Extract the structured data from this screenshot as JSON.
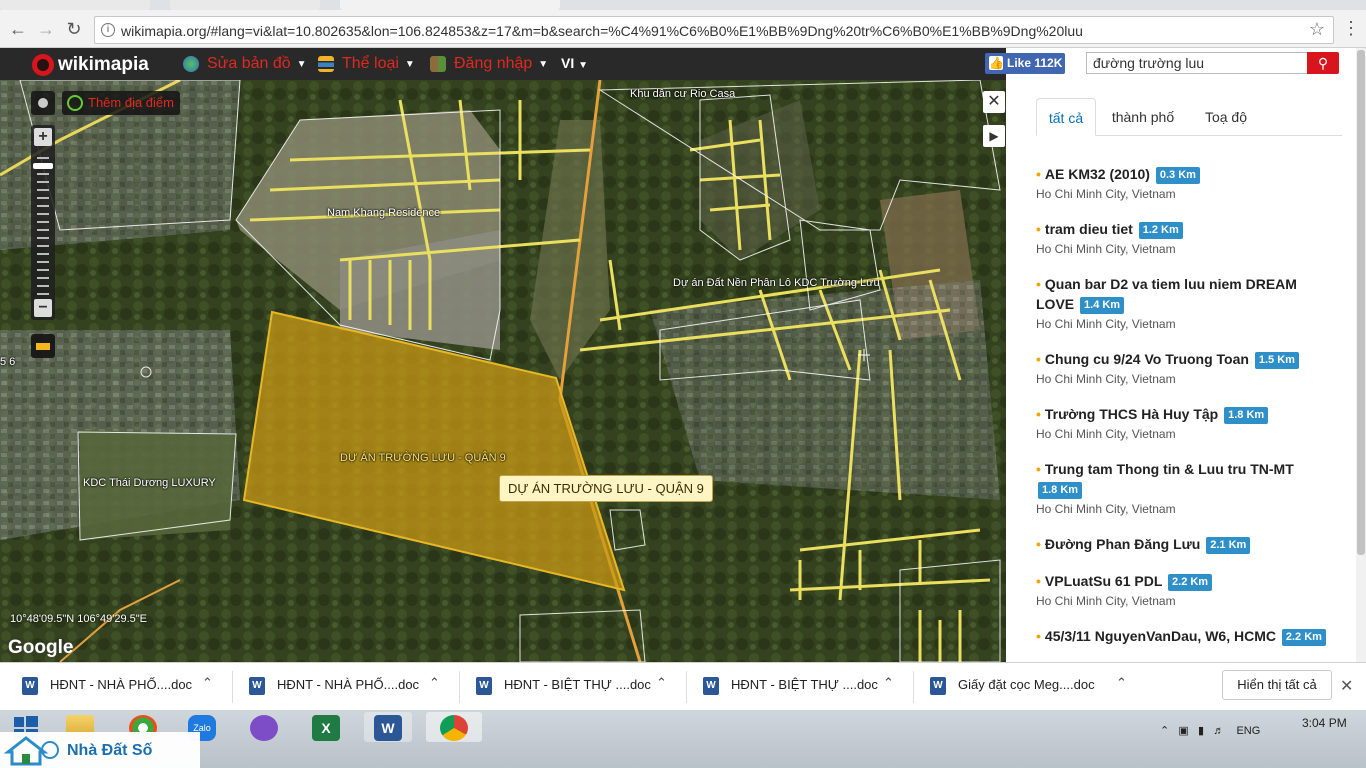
{
  "browser": {
    "url": "wikimapia.org/#lang=vi&lat=10.802635&lon=106.824853&z=17&m=b&search=%C4%91%C6%B0%E1%BB%9Dng%20tr%C6%B0%E1%BB%9Dng%20luu"
  },
  "header": {
    "logo": "wikimapia",
    "menu": [
      "Sửa bản đồ",
      "Thể loại",
      "Đăng nhập"
    ],
    "lang": "VI",
    "fb_like": "Like 112K",
    "search_value": "đường trường luu"
  },
  "map": {
    "add_place": "Thêm địa điểm",
    "labels": {
      "rio_casa": "Khu dân cư Rio Casa",
      "nam_khang": "Nam Khang Residence",
      "du_an_kdc": "Dự án Đất Nền Phân Lô KDC Trường Lưu",
      "du_an_center": "DỰ ÁN TRƯỜNG LƯU - QUẬN 9",
      "kdc_thai_duong": "KDC Thái Dương LUXURY",
      "left_edge": "5 6"
    },
    "tooltip": "DỰ ÁN TRƯỜNG LƯU - QUẬN 9",
    "coordinates": "10°48'09.5\"N 106°49'29.5\"E",
    "attribution": "Google"
  },
  "panel": {
    "tabs": [
      "tất cả",
      "thành phố",
      "Toạ độ"
    ],
    "results": [
      {
        "title": "AE KM32 (2010)",
        "dist": "0.3 Km",
        "sub": "Ho Chi Minh City, Vietnam"
      },
      {
        "title": "tram dieu tiet",
        "dist": "1.2 Km",
        "sub": "Ho Chi Minh City, Vietnam"
      },
      {
        "title": "Quan bar D2 va tiem luu niem DREAM LOVE",
        "dist": "1.4 Km",
        "sub": "Ho Chi Minh City, Vietnam"
      },
      {
        "title": "Chung cu 9/24 Vo Truong Toan",
        "dist": "1.5 Km",
        "sub": "Ho Chi Minh City, Vietnam"
      },
      {
        "title": "Trường THCS Hà Huy Tập",
        "dist": "1.8 Km",
        "sub": "Ho Chi Minh City, Vietnam"
      },
      {
        "title": "Trung tam Thong tin & Luu tru TN-MT",
        "dist": "1.8 Km",
        "sub": "Ho Chi Minh City, Vietnam"
      },
      {
        "title": "Đường Phan Đăng Lưu",
        "dist": "2.1 Km",
        "sub": ""
      },
      {
        "title": "VPLuatSu 61 PDL",
        "dist": "2.2 Km",
        "sub": "Ho Chi Minh City, Vietnam"
      },
      {
        "title": "45/3/11 NguyenVanDau, W6, HCMC",
        "dist": "2.2 Km",
        "sub": ""
      }
    ]
  },
  "downloads": {
    "items": [
      "HĐNT - NHÀ PHỐ....doc",
      "HĐNT - NHÀ PHỐ....doc",
      "HĐNT - BIỆT THỰ ....doc",
      "HĐNT - BIỆT THỰ ....doc",
      "Giấy đặt cọc Meg....doc"
    ],
    "show_all": "Hiển thị tất cả"
  },
  "taskbar": {
    "tray_lang": "ENG",
    "clock": "3:04 PM",
    "apps": [
      "start-icon",
      "file-explorer-icon",
      "coccoc-icon",
      "zalo-icon",
      "viber-icon",
      "excel-icon",
      "word-icon",
      "chrome-icon"
    ]
  },
  "watermark": {
    "brand": "Nhà Đất Số"
  }
}
